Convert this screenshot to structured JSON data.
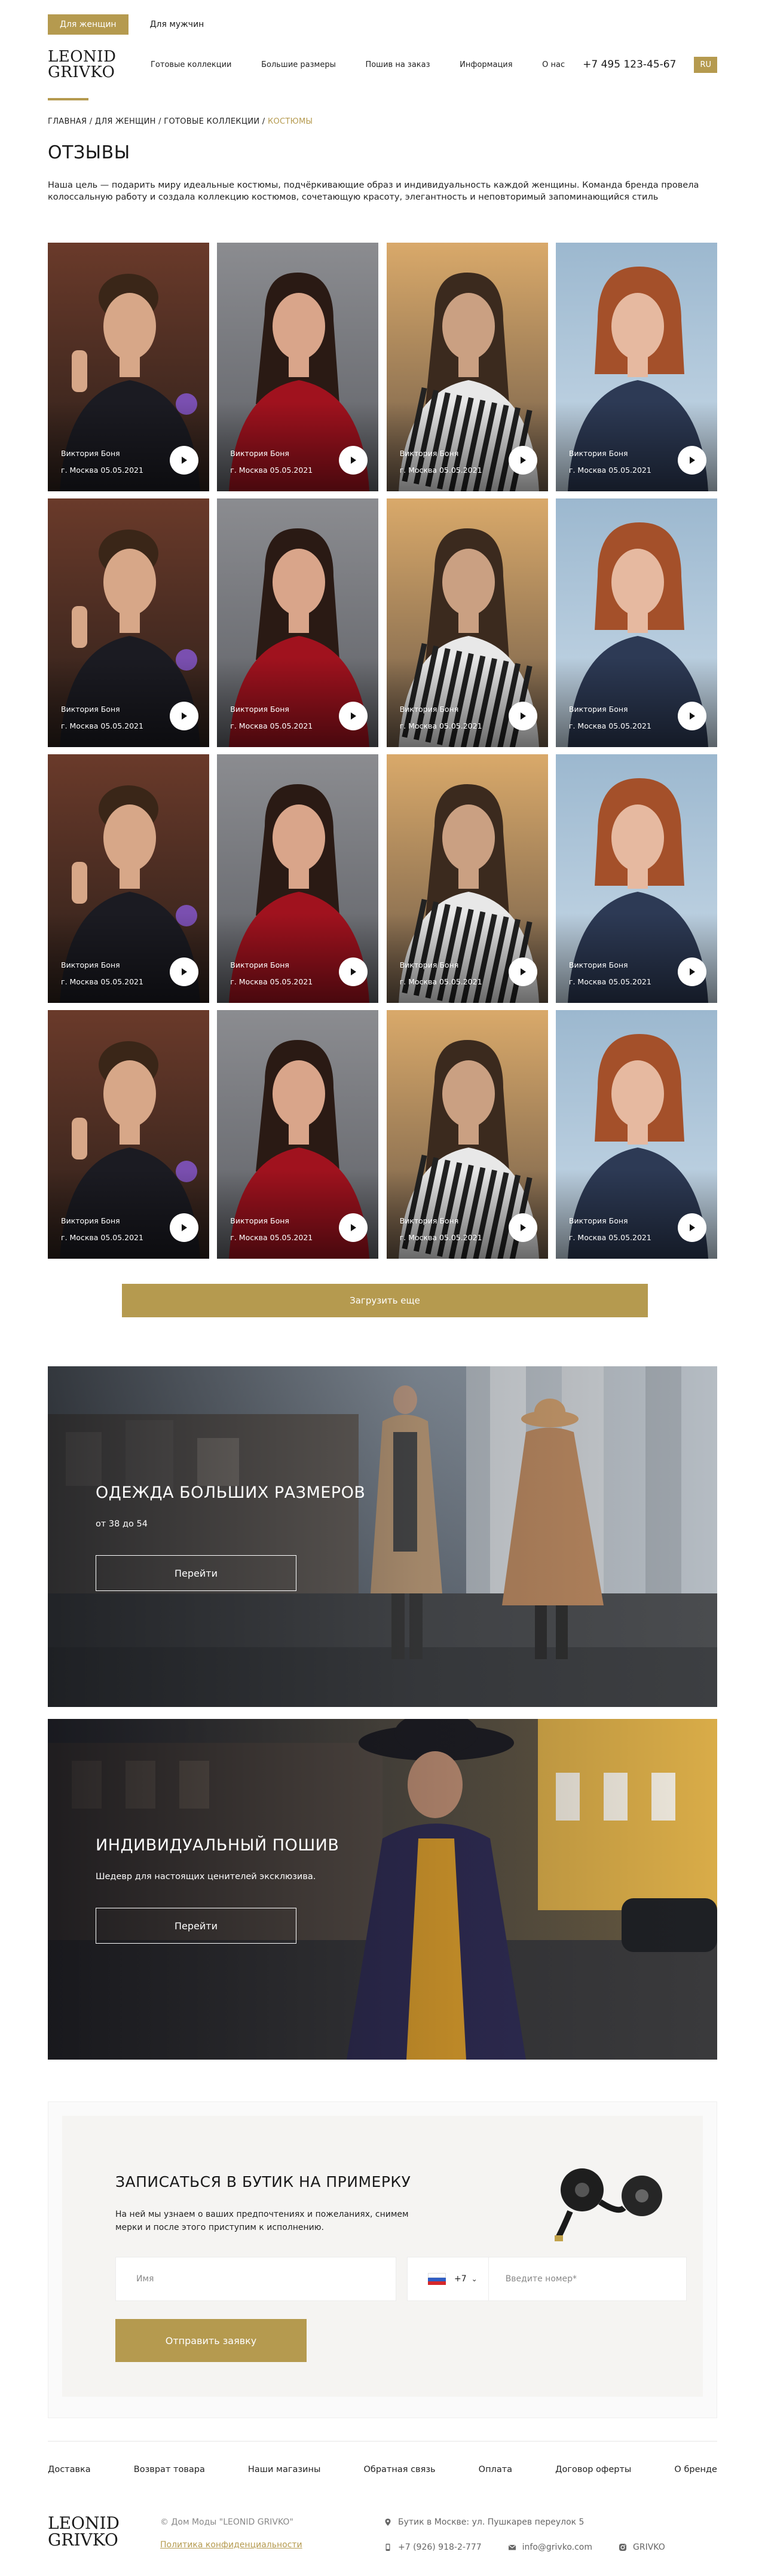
{
  "gender": {
    "women": "Для женщин",
    "men": "Для мужчин"
  },
  "header": {
    "logo_line1": "LEONID",
    "logo_line2": "GRIVKO",
    "nav": [
      "Готовые коллекции",
      "Большие размеры",
      "Пошив на заказ",
      "Информация",
      "О нас"
    ],
    "phone": "+7 495 123-45-67",
    "lang": "RU"
  },
  "breadcrumb": {
    "path": "ГЛАВНАЯ / ДЛЯ ЖЕНЩИН / ГОТОВЫЕ КОЛЛЕКЦИИ / ",
    "current": "КОСТЮМЫ"
  },
  "page": {
    "title": "ОТЗЫВЫ",
    "intro": "Наша цель — подарить миру идеальные костюмы, подчёркивающие образ и индивидуальность каждой женщины. Команда бренда провела колоссальную работу и создала коллекцию костюмов, сочетающую красоту, элегантность и неповторимый запоминающийся стиль"
  },
  "reviews": [
    {
      "name": "Виктория Боня",
      "city": "г. Москва 05.05.2021"
    },
    {
      "name": "Виктория Боня",
      "city": "г. Москва 05.05.2021"
    },
    {
      "name": "Виктория Боня",
      "city": "г. Москва 05.05.2021"
    },
    {
      "name": "Виктория Боня",
      "city": "г. Москва 05.05.2021"
    },
    {
      "name": "Виктория Боня",
      "city": "г. Москва 05.05.2021"
    },
    {
      "name": "Виктория Боня",
      "city": "г. Москва 05.05.2021"
    },
    {
      "name": "Виктория Боня",
      "city": "г. Москва 05.05.2021"
    },
    {
      "name": "Виктория Боня",
      "city": "г. Москва 05.05.2021"
    },
    {
      "name": "Виктория Боня",
      "city": "г. Москва 05.05.2021"
    },
    {
      "name": "Виктория Боня",
      "city": "г. Москва 05.05.2021"
    },
    {
      "name": "Виктория Боня",
      "city": "г. Москва 05.05.2021"
    },
    {
      "name": "Виктория Боня",
      "city": "г. Москва 05.05.2021"
    },
    {
      "name": "Виктория Боня",
      "city": "г. Москва 05.05.2021"
    },
    {
      "name": "Виктория Боня",
      "city": "г. Москва 05.05.2021"
    },
    {
      "name": "Виктория Боня",
      "city": "г. Москва 05.05.2021"
    },
    {
      "name": "Виктория Боня",
      "city": "г. Москва 05.05.2021"
    }
  ],
  "load_more": "Загрузить еще",
  "banner1": {
    "title": "ОДЕЖДА БОЛЬШИХ РАЗМЕРОВ",
    "subtitle": "от 38 до 54",
    "button": "Перейти"
  },
  "banner2": {
    "title": "ИНДИВИДУАЛЬНЫЙ ПОШИВ",
    "subtitle": "Шедевр для настоящих ценителей эксклюзива.",
    "button": "Перейти"
  },
  "appointment": {
    "title": "ЗАПИСАТЬСЯ В БУТИК НА ПРИМЕРКУ",
    "text": "На ней мы узнаем о ваших предпочтениях и пожеланиях, снимем мерки и после этого приступим к исполнению.",
    "name_placeholder": "Имя",
    "phone_code": "+7",
    "phone_placeholder": "Введите номер*",
    "submit": "Отправить заявку"
  },
  "footer": {
    "nav": [
      "Доставка",
      "Возврат товара",
      "Наши магазины",
      "Обратная связь",
      "Оплата",
      "Договор оферты",
      "О бренде"
    ],
    "copyright": "© Дом Моды \"LEONID GRIVKO\"",
    "policy": "Политика конфиденциальности",
    "address": "Бутик в Москве: ул. Пушкарев переулок 5",
    "phone": "+7 (926) 918-2-777",
    "email": "info@grivko.com",
    "instagram": "GRIVKO"
  },
  "colors": {
    "accent": "#b59a4f"
  }
}
